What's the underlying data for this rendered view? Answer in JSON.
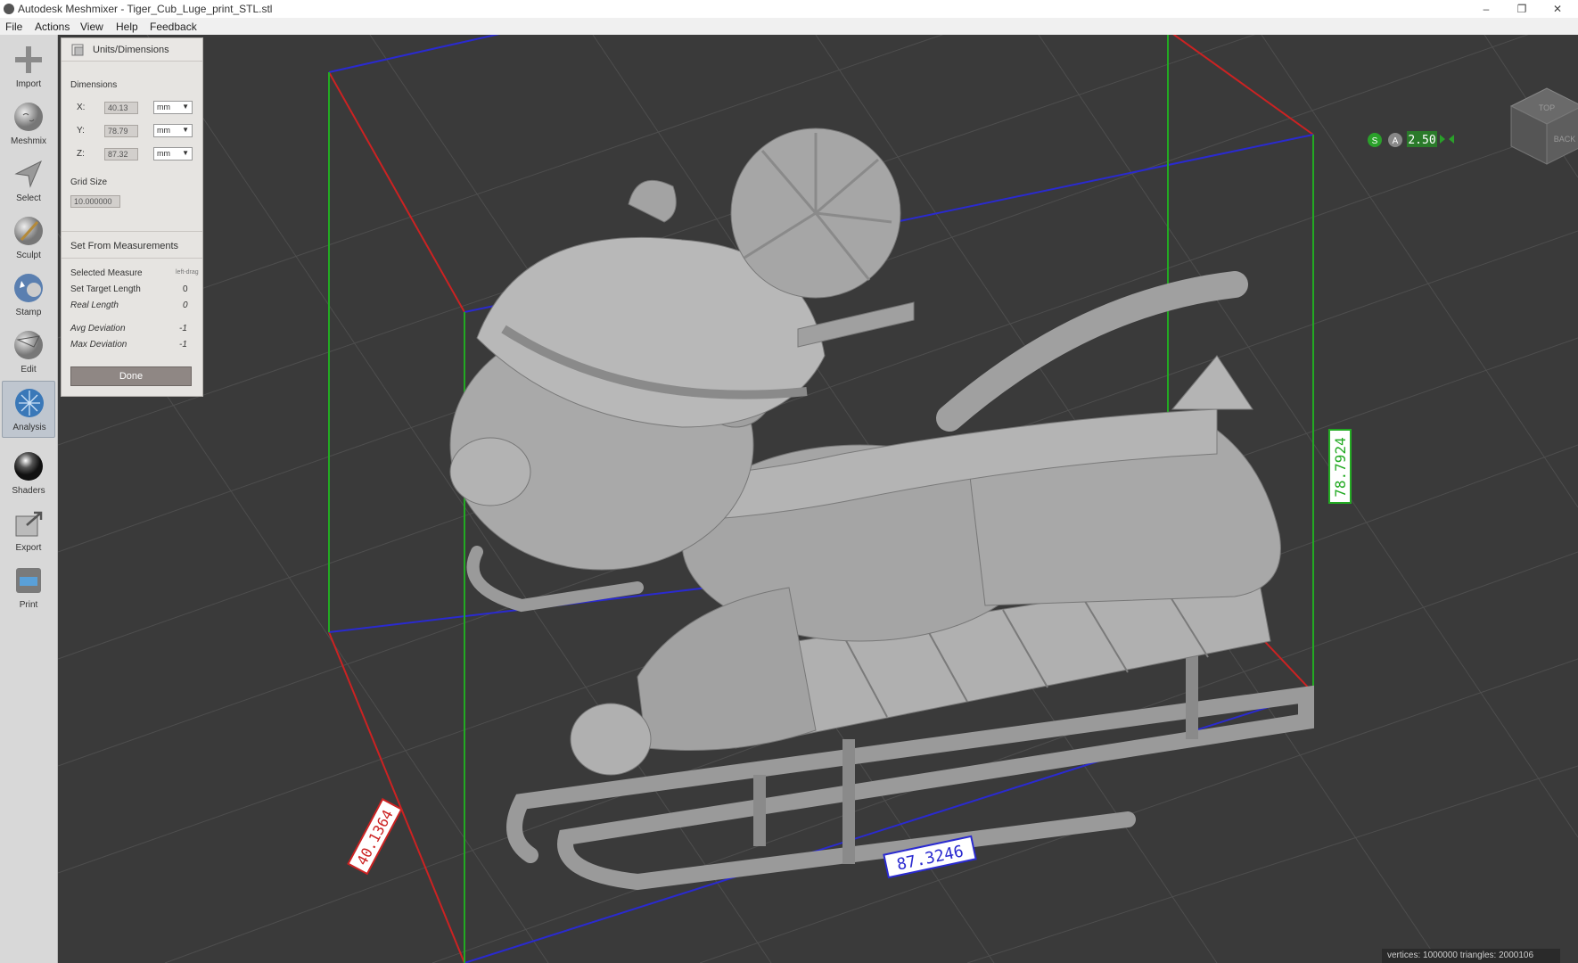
{
  "window": {
    "title": "Autodesk Meshmixer - Tiger_Cub_Luge_print_STL.stl"
  },
  "menu": [
    "File",
    "Actions",
    "View",
    "Help",
    "Feedback"
  ],
  "toolbar": [
    {
      "name": "import",
      "label": "Import",
      "icon": "plus-icon"
    },
    {
      "name": "meshmix",
      "label": "Meshmix",
      "icon": "sphere-face-icon"
    },
    {
      "name": "select",
      "label": "Select",
      "icon": "arrow-icon"
    },
    {
      "name": "sculpt",
      "label": "Sculpt",
      "icon": "brush-icon"
    },
    {
      "name": "stamp",
      "label": "Stamp",
      "icon": "stamp-icon"
    },
    {
      "name": "edit",
      "label": "Edit",
      "icon": "edit-sphere-icon"
    },
    {
      "name": "analysis",
      "label": "Analysis",
      "icon": "analysis-icon"
    },
    {
      "name": "shaders",
      "label": "Shaders",
      "icon": "shader-sphere-icon"
    },
    {
      "name": "export",
      "label": "Export",
      "icon": "export-icon"
    },
    {
      "name": "print",
      "label": "Print",
      "icon": "printer-icon"
    }
  ],
  "active_tool": "analysis",
  "panel": {
    "title": "Units/Dimensions",
    "dimensions_label": "Dimensions",
    "x_label": "X:",
    "x_value": "40.13",
    "y_label": "Y:",
    "y_value": "78.79",
    "z_label": "Z:",
    "z_value": "87.32",
    "unit": "mm",
    "grid_size_label": "Grid Size",
    "grid_size_value": "10.000000",
    "set_from_measurements": "Set From Measurements",
    "selected_measure_label": "Selected Measure",
    "selected_measure_value": "left-drag",
    "set_target_length_label": "Set Target Length",
    "set_target_length_value": "0",
    "real_length_label": "Real Length",
    "real_length_value": "0",
    "avg_deviation_label": "Avg Deviation",
    "avg_deviation_value": "-1",
    "max_deviation_label": "Max Deviation",
    "max_deviation_value": "-1",
    "done_label": "Done"
  },
  "viewport": {
    "dim_x_readout": "40.1364",
    "dim_y_readout": "78.7924",
    "dim_z_readout": "87.3246",
    "grid_value": "2.50",
    "snap_s": "S",
    "snap_a": "A",
    "viewcube_top": "TOP",
    "viewcube_back": "BACK"
  },
  "status": {
    "text": "vertices: 1000000 triangles: 2000106"
  },
  "colors": {
    "x_axis": "#cc2222",
    "y_axis": "#22aa22",
    "z_axis": "#2222cc",
    "grid": "#4e4e4e",
    "background": "#3a3a3a",
    "mesh": "#a8a8a8"
  }
}
